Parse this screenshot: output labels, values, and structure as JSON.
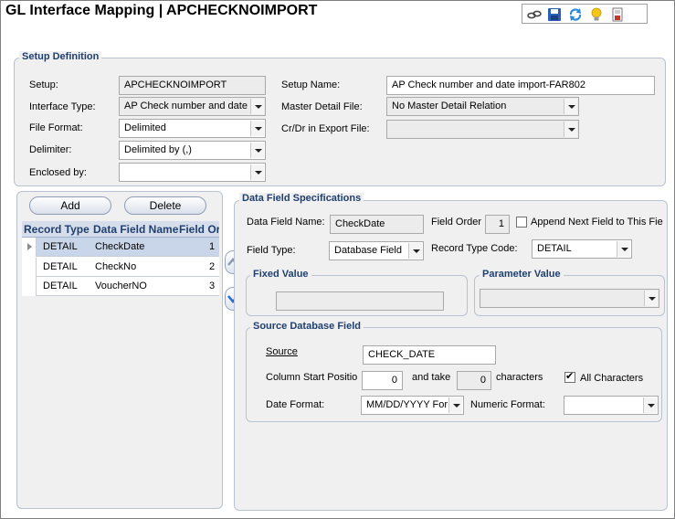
{
  "window": {
    "title": "GL Interface Mapping  |  APCHECKNOIMPORT"
  },
  "toolbar": {
    "icons": [
      "link-icon",
      "save-icon",
      "refresh-icon",
      "lightbulb-icon",
      "report-icon"
    ]
  },
  "setup_definition": {
    "title": "Setup Definition",
    "setup_label": "Setup:",
    "setup_value": "APCHECKNOIMPORT",
    "interface_type_label": "Interface Type:",
    "interface_type_value": "AP Check number and date",
    "file_format_label": "File Format:",
    "file_format_value": "Delimited",
    "delimiter_label": "Delimiter:",
    "delimiter_value": "Delimited by (,)",
    "enclosed_by_label": "Enclosed by:",
    "enclosed_by_value": "",
    "setup_name_label": "Setup Name:",
    "setup_name_value": "AP Check number and date import-FAR802",
    "master_detail_label": "Master Detail File:",
    "master_detail_value": "No Master Detail Relation",
    "crdr_label": "Cr/Dr in Export File:",
    "crdr_value": ""
  },
  "grid": {
    "add_label": "Add",
    "delete_label": "Delete",
    "headers": [
      "Record Type",
      "Data Field Name",
      "Field Or"
    ],
    "rows": [
      {
        "record_type": "DETAIL",
        "field_name": "CheckDate",
        "order": "1",
        "selected": true
      },
      {
        "record_type": "DETAIL",
        "field_name": "CheckNo",
        "order": "2",
        "selected": false
      },
      {
        "record_type": "DETAIL",
        "field_name": "VoucherNO",
        "order": "3",
        "selected": false
      }
    ]
  },
  "spec": {
    "title": "Data Field Specifications",
    "field_name_label": "Data Field Name:",
    "field_name_value": "CheckDate",
    "field_order_label": "Field Order",
    "field_order_value": "1",
    "append_label": "Append Next Field to This Fie",
    "field_type_label": "Field Type:",
    "field_type_value": "Database Field",
    "record_type_code_label": "Record Type Code:",
    "record_type_code_value": "DETAIL",
    "fixed_value_title": "Fixed Value",
    "fixed_value": "",
    "parameter_value_title": "Parameter Value",
    "parameter_value": "",
    "source_db_title": "Source Database Field",
    "source_label": "Source",
    "source_value": "CHECK_DATE",
    "column_start_label": "Column Start Positio",
    "column_start_value": "0",
    "and_take_label": "and take",
    "take_value": "0",
    "characters_label": "characters",
    "all_characters_label": "All Characters",
    "all_characters_checked": true,
    "date_format_label": "Date Format:",
    "date_format_value": "MM/DD/YYYY For",
    "numeric_format_label": "Numeric Format:",
    "numeric_format_value": ""
  }
}
